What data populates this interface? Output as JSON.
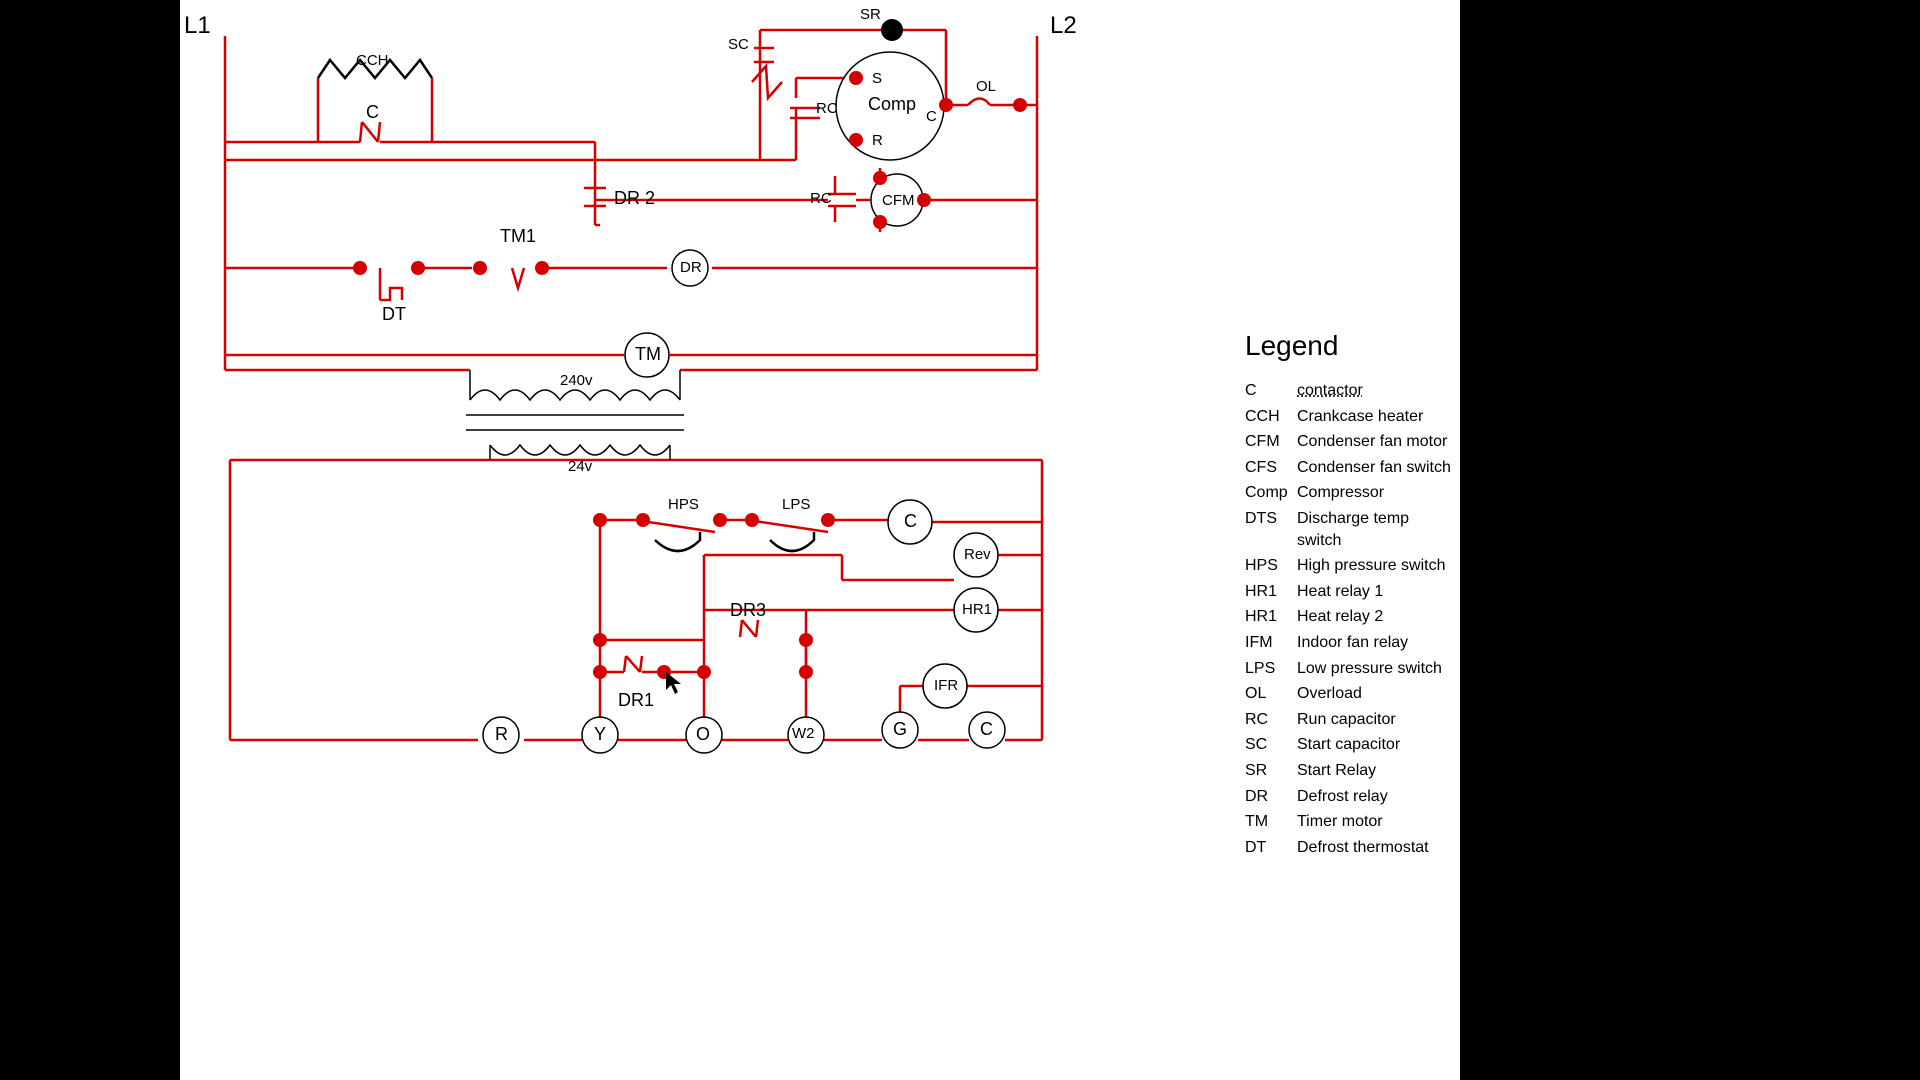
{
  "rails": {
    "L1": "L1",
    "L2": "L2"
  },
  "components": {
    "CCH": "CCH",
    "C": "C",
    "SC": "SC",
    "SR": "SR",
    "RC1": "RC",
    "S": "S",
    "Cterm": "C",
    "Rterm": "R",
    "Comp": "Comp",
    "OL": "OL",
    "DR2": "DR 2",
    "RC2": "RC",
    "CFM": "CFM",
    "DT": "DT",
    "TM1": "TM1",
    "DR": "DR",
    "TM": "TM",
    "v240": "240v",
    "v24": "24v",
    "HPS": "HPS",
    "LPS": "LPS",
    "Ccoil": "C",
    "Rev": "Rev",
    "HR1": "HR1",
    "DR3": "DR3",
    "DR1": "DR1",
    "IFR": "IFR",
    "R": "R",
    "Y": "Y",
    "O": "O",
    "W2": "W2",
    "G": "G",
    "Cterm2": "C"
  },
  "legend": {
    "title": "Legend",
    "items": [
      {
        "abbr": "C",
        "def": "contactor",
        "dotted": true
      },
      {
        "abbr": "CCH",
        "def": "Crankcase heater"
      },
      {
        "abbr": "CFM",
        "def": "Condenser fan motor"
      },
      {
        "abbr": "CFS",
        "def": "Condenser fan switch"
      },
      {
        "abbr": "Comp",
        "def": "Compressor"
      },
      {
        "abbr": "DTS",
        "def": "Discharge temp switch"
      },
      {
        "abbr": "HPS",
        "def": "High pressure switch"
      },
      {
        "abbr": "HR1",
        "def": "Heat relay 1"
      },
      {
        "abbr": "HR1",
        "def": "Heat relay 2"
      },
      {
        "abbr": "IFM",
        "def": "Indoor fan relay"
      },
      {
        "abbr": "LPS",
        "def": "Low pressure switch"
      },
      {
        "abbr": "OL",
        "def": "Overload"
      },
      {
        "abbr": "RC",
        "def": "Run capacitor"
      },
      {
        "abbr": "SC",
        "def": "Start capacitor"
      },
      {
        "abbr": "SR",
        "def": "Start Relay"
      },
      {
        "abbr": "DR",
        "def": "Defrost relay"
      },
      {
        "abbr": "TM",
        "def": "Timer motor"
      },
      {
        "abbr": "DT",
        "def": "Defrost thermostat"
      }
    ]
  }
}
